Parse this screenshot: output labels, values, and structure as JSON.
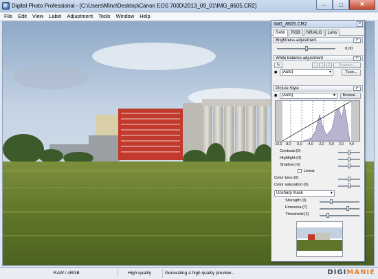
{
  "window": {
    "title": "Digital Photo Professional - [C:\\Users\\Mino\\Desktop\\Canon EOS 700D\\2013_09_01\\IMG_8605.CR2]",
    "minimize": "–",
    "maximize": "□",
    "close": "✕"
  },
  "menu": [
    "File",
    "Edit",
    "View",
    "Label",
    "Adjustment",
    "Tools",
    "Window",
    "Help"
  ],
  "palette": {
    "title": "IMG_8605.CR2",
    "close": "×",
    "tabs": [
      "RAW",
      "RGB",
      "NR/ALO",
      "Lens"
    ],
    "brightness": {
      "label": "Brightness adjustment",
      "value": "0,00",
      "level": 0.5
    },
    "white_balance": {
      "label": "White balance adjustment",
      "presets": [
        "1",
        "2",
        "3"
      ],
      "register": "Register...",
      "mode": "(Auto)",
      "tune": "Tune..."
    },
    "picture_style": {
      "label": "Picture Style",
      "value": "(Auto)",
      "browse": "Browse...",
      "histogram_ticks": [
        "-10,0",
        "-8,0",
        "-6,0",
        "-4,0",
        "-2,0",
        "0,0",
        "2,0",
        "4,0"
      ]
    },
    "adjustments": [
      {
        "label": "Contrast:(0)",
        "level": 0.5
      },
      {
        "label": "Highlight:(0)",
        "level": 0.5
      },
      {
        "label": "Shadow:(0)",
        "level": 0.5
      }
    ],
    "linear_label": "Linear",
    "color_tone": {
      "label": "Color tone:(0)",
      "level": 0.5
    },
    "color_saturation": {
      "label": "Color saturation:(0)",
      "level": 0.5
    },
    "sharpness_mode": "Unsharp mask",
    "sharpness": [
      {
        "label": "Strength:(3)",
        "level": 0.3
      },
      {
        "label": "Fineness:(7)",
        "level": 0.7
      },
      {
        "label": "Threshold:(2)",
        "level": 0.2
      }
    ]
  },
  "status": {
    "color_mode": "RAW / sRGB",
    "quality": "High quality",
    "message": "Generating a high quality preview...",
    "watermark_a": "DIGI",
    "watermark_b": "MANIE"
  }
}
